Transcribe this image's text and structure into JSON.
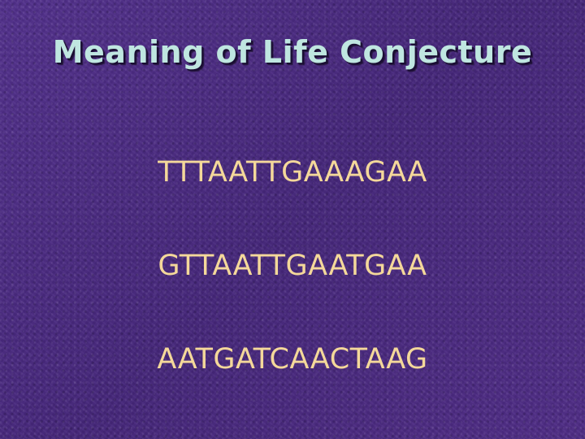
{
  "slide": {
    "title": "Meaning of Life Conjecture",
    "sequences": [
      "TTTAATTGAAAGAA",
      "GTTAATTGAATGAA",
      "AATGATCAACTAAG"
    ]
  },
  "colors": {
    "background": "#4a2a80",
    "title": "#bfe6e0",
    "sequence_text": "#f4d89a"
  }
}
